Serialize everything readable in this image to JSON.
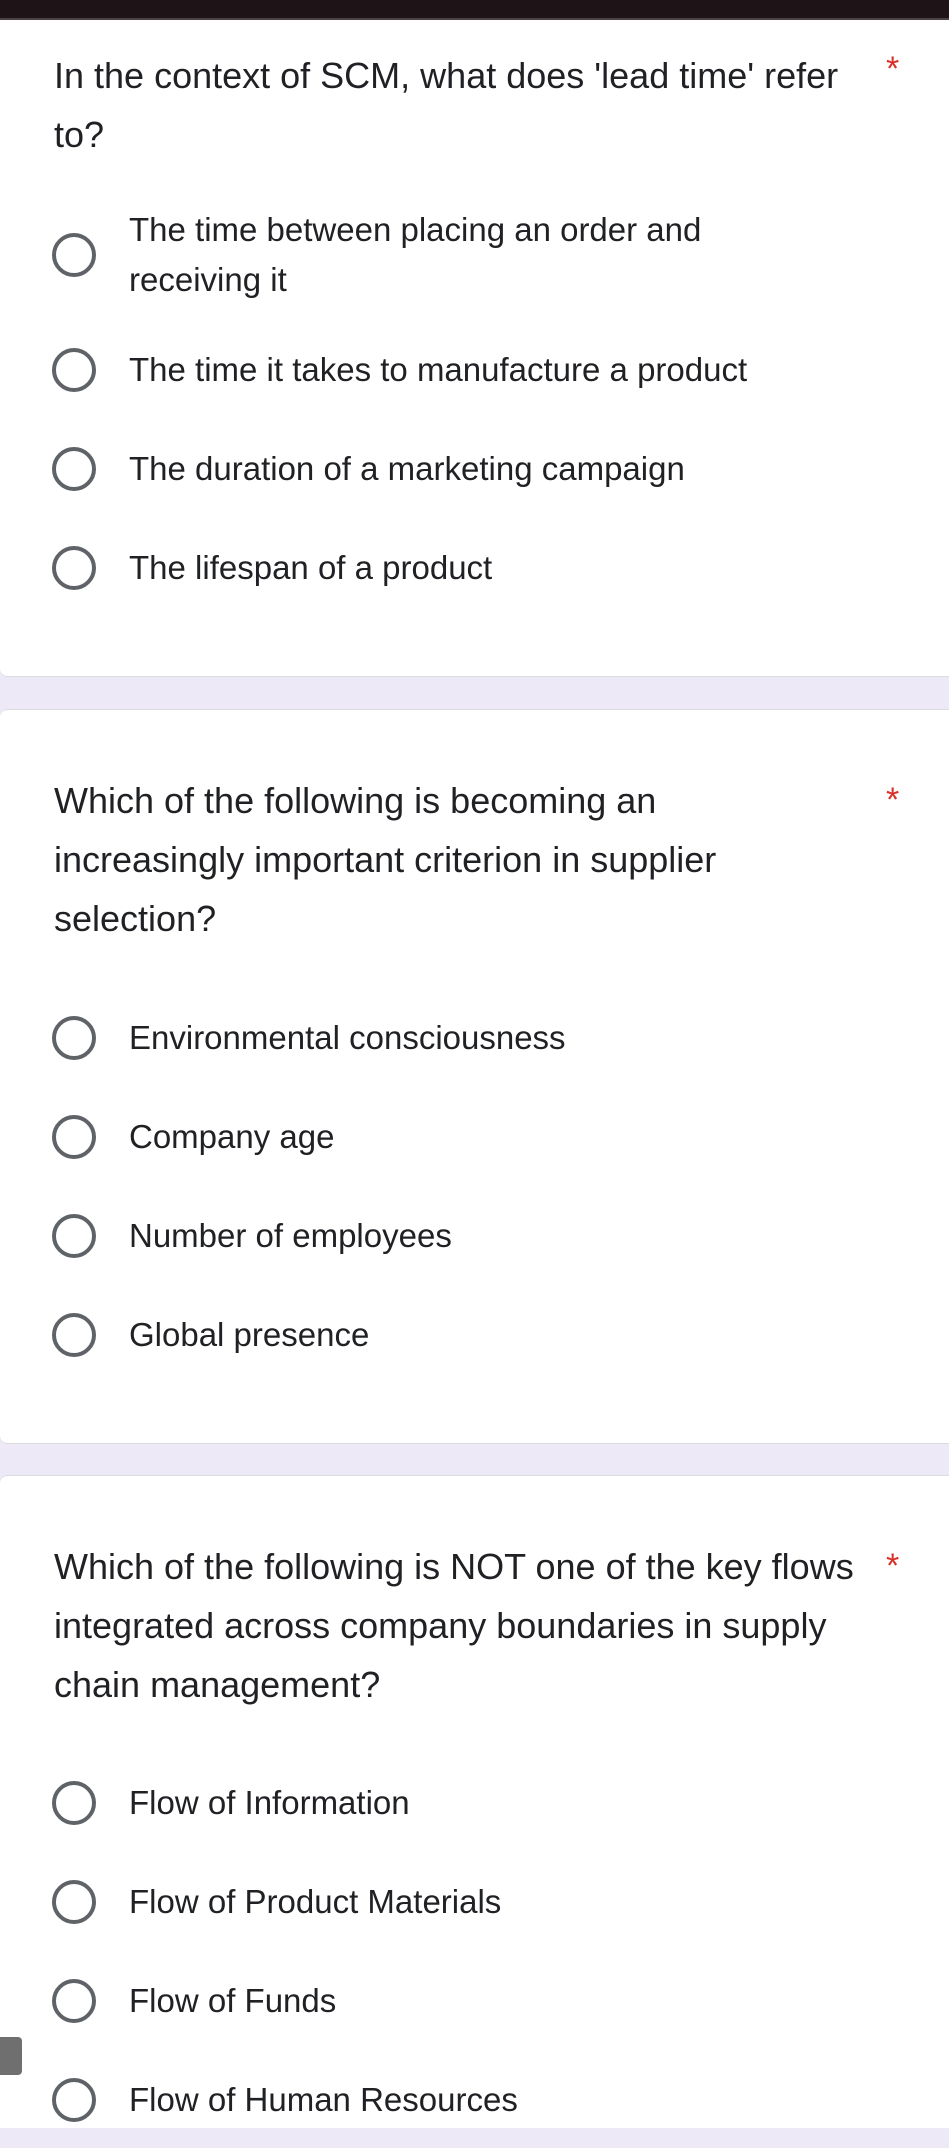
{
  "questions": [
    {
      "text": "In the context of SCM, what does 'lead time' refer to?",
      "required_mark": "*",
      "options": [
        "The time between placing an order and receiving it",
        "The time it takes to manufacture a product",
        "The duration of a marketing campaign",
        "The lifespan of a product"
      ]
    },
    {
      "text": "Which of the following is becoming an increasingly important criterion in supplier selection?",
      "required_mark": "*",
      "options": [
        "Environmental consciousness",
        "Company age",
        "Number of employees",
        "Global presence"
      ]
    },
    {
      "text": "Which of the following is NOT one of the key flows integrated across company boundaries in supply chain management?",
      "required_mark": "*",
      "options": [
        "Flow of Information",
        "Flow of Product Materials",
        "Flow of Funds",
        "Flow of Human Resources"
      ]
    }
  ],
  "colors": {
    "background": "#ede9f7",
    "card": "#ffffff",
    "required": "#d93025",
    "radio_border": "#5f6368",
    "text": "#202124"
  }
}
